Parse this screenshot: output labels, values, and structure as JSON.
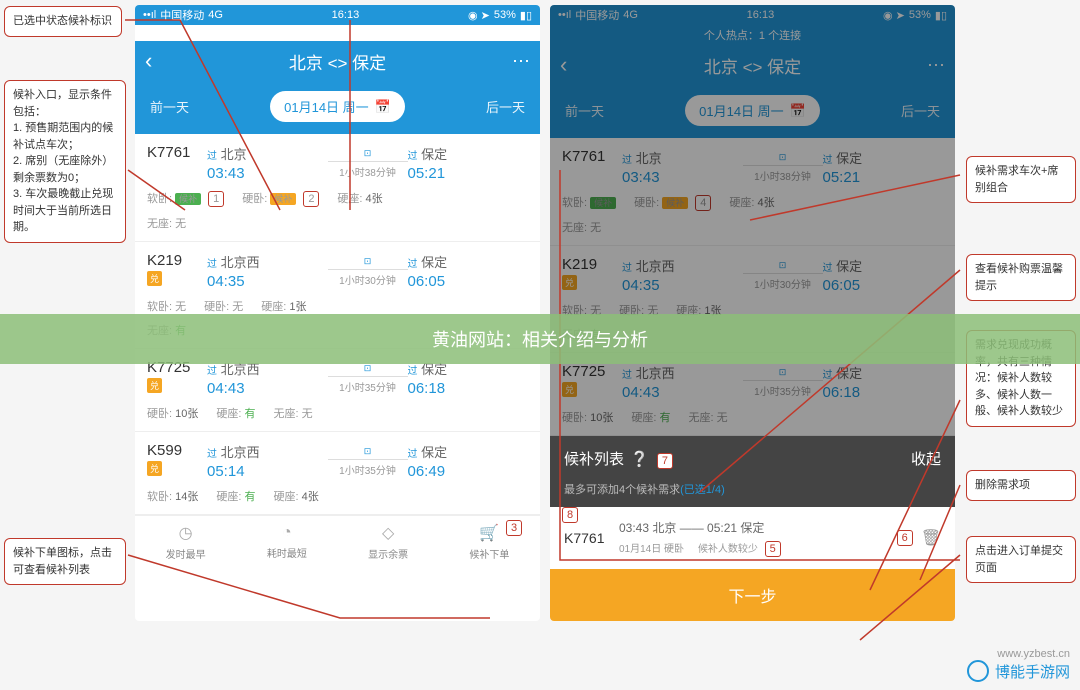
{
  "status": {
    "carrier": "中国移动",
    "net": "4G",
    "time": "16:13",
    "battery": "53%"
  },
  "hotspot": "个人热点：1 个连接",
  "header": {
    "title": "北京 <> 保定",
    "prev": "前一天",
    "date": "01月14日 周一",
    "next": "后一天"
  },
  "trains": [
    {
      "num": "K7761",
      "badge": "",
      "from": "北京",
      "from_time": "03:43",
      "to": "保定",
      "to_time": "05:21",
      "duration": "1小时38分钟",
      "tickets": [
        {
          "label": "软卧:",
          "val": "候补",
          "hb": true
        },
        {
          "label": "硬卧:",
          "val": "候补",
          "hb": true
        },
        {
          "label": "硬座:",
          "val": "4张"
        }
      ],
      "tickets2": [
        {
          "label": "无座:",
          "val": "无"
        }
      ]
    },
    {
      "num": "K219",
      "badge": "兑",
      "from": "北京西",
      "from_time": "04:35",
      "to": "保定",
      "to_time": "06:05",
      "duration": "1小时30分钟",
      "tickets": [
        {
          "label": "软卧:",
          "val": "无"
        },
        {
          "label": "硬卧:",
          "val": "无"
        },
        {
          "label": "硬座:",
          "val": "1张"
        }
      ],
      "tickets2": [
        {
          "label": "无座:",
          "val": "有"
        }
      ]
    },
    {
      "num": "K7725",
      "badge": "兑",
      "from": "北京西",
      "from_time": "04:43",
      "to": "保定",
      "to_time": "06:18",
      "duration": "1小时35分钟",
      "tickets": [
        {
          "label": "硬卧:",
          "val": "10张"
        },
        {
          "label": "硬座:",
          "val": "有"
        },
        {
          "label": "无座:",
          "val": "无"
        }
      ],
      "tickets2": []
    },
    {
      "num": "K599",
      "badge": "兑",
      "from": "北京西",
      "from_time": "05:14",
      "to": "保定",
      "to_time": "06:49",
      "duration": "1小时35分钟",
      "tickets": [
        {
          "label": "软卧:",
          "val": "14张"
        },
        {
          "label": "硬座:",
          "val": "有"
        },
        {
          "label": "硬座:",
          "val": "4张"
        }
      ],
      "tickets2": []
    }
  ],
  "tabs": [
    {
      "label": "发时最早",
      "icon": "◷"
    },
    {
      "label": "耗时最短",
      "icon": "◔"
    },
    {
      "label": "显示余票",
      "icon": "◇"
    },
    {
      "label": "候补下单",
      "icon": "🛒"
    }
  ],
  "waitlist": {
    "title": "候补列表",
    "collapse": "收起",
    "sub1": "最多可添加4个候补需求",
    "sub2": "(已选1/4)",
    "row": {
      "id": "K7761",
      "line1": "03:43 北京 —— 05:21 保定",
      "line2": "01月14日 硬卧",
      "status": "候补人数较少"
    },
    "next": "下一步"
  },
  "overlay": "黄油网站：相关介绍与分析",
  "watermark": {
    "name": "博能手游网",
    "url": "www.yzbest.cn"
  },
  "annotations": {
    "a1": "已选中状态候补标识",
    "a2": "候补入口，显示条件包括：\n1. 预售期范围内的候补试点车次；\n2. 席别（无座除外）剩余票数为0；\n3. 车次最晚截止兑现时间大于当前所选日期。",
    "a3": "候补下单图标，点击可查看候补列表",
    "b1": "候补需求车次+席别组合",
    "b2": "查看候补购票温馨提示",
    "b3": "需求兑现成功概率，共有三种情况：候补人数较多、候补人数一般、候补人数较少",
    "b4": "删除需求项",
    "b5": "点击进入订单提交页面"
  },
  "nums": {
    "n1": "1",
    "n2": "2",
    "n3": "3",
    "n4": "4",
    "n5": "5",
    "n6": "6",
    "n7": "7",
    "n8": "8"
  }
}
